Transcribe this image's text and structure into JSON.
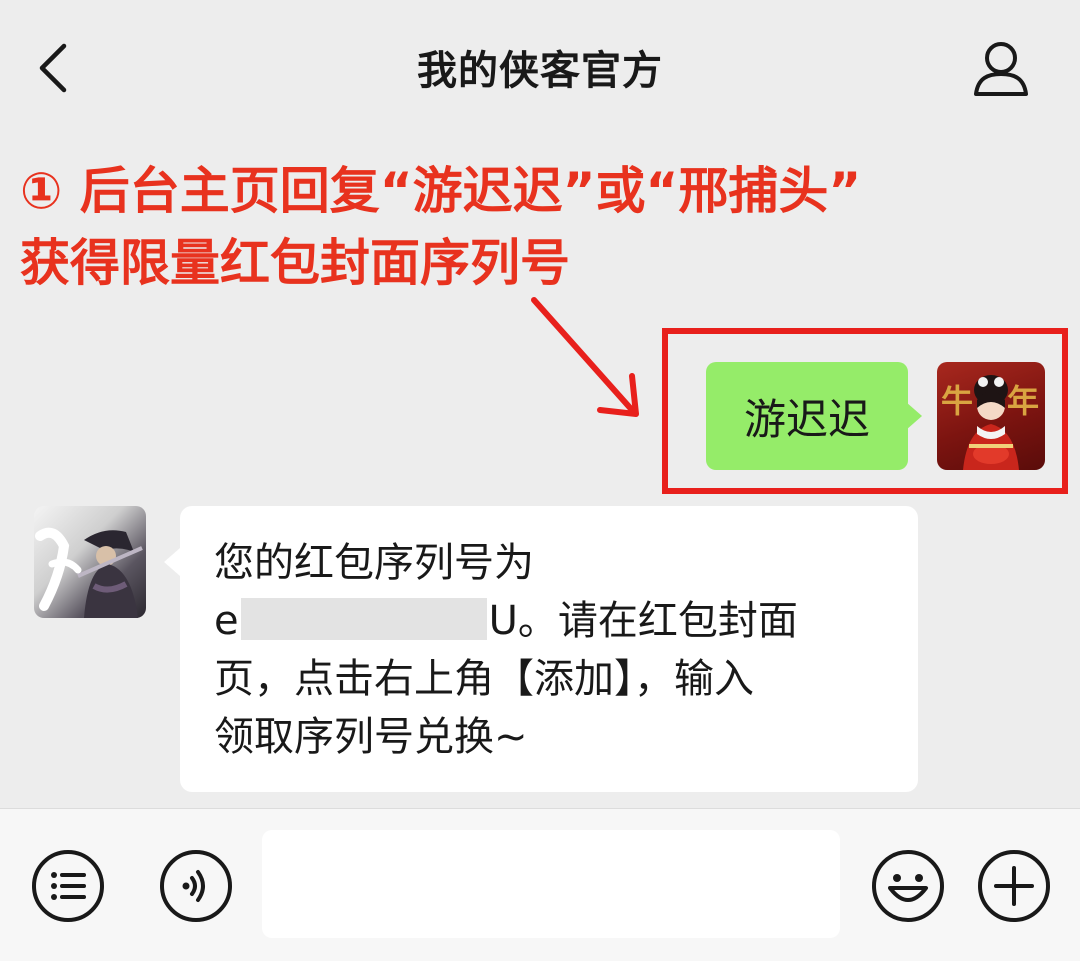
{
  "header": {
    "title": "我的侠客官方",
    "back_icon": "chevron-left-icon",
    "profile_icon": "person-icon"
  },
  "annotation": {
    "line1": "① 后台主页回复“游迟迟”或“邢捕头”",
    "line2": "获得限量红包封面序列号",
    "color": "#e8321e"
  },
  "messages": {
    "sent": {
      "text": "游迟迟",
      "bubble_color": "#95ec69",
      "avatar_text": "牛年"
    },
    "received": {
      "line1": "您的红包序列号为",
      "serial_prefix": "e",
      "serial_suffix": "U。请在红包封面",
      "line3": "页，点击右上角【添加】，输入",
      "line4": "领取序列号兑换~"
    }
  },
  "input_bar": {
    "menu_icon": "list-menu-icon",
    "voice_icon": "voice-icon",
    "emoji_icon": "emoji-icon",
    "plus_icon": "plus-icon",
    "input_value": ""
  }
}
